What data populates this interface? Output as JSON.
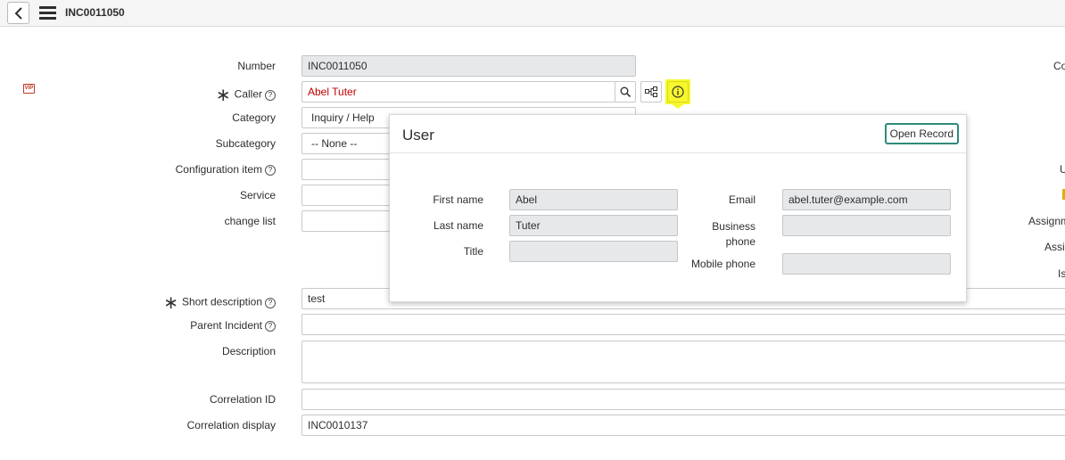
{
  "header": {
    "title": "INC0011050"
  },
  "form": {
    "number_label": "Number",
    "number_value": "INC0011050",
    "caller_label": "Caller",
    "caller_value": "Abel Tuter",
    "category_label": "Category",
    "category_value": "Inquiry / Help",
    "subcategory_label": "Subcategory",
    "subcategory_value": "-- None --",
    "config_item_label": "Configuration item",
    "service_label": "Service",
    "change_list_label": "change list",
    "short_desc_label": "Short description",
    "short_desc_value": "test",
    "parent_incident_label": "Parent Incident",
    "description_label": "Description",
    "correlation_id_label": "Correlation ID",
    "correlation_display_label": "Correlation display",
    "correlation_display_value": "INC0010137",
    "help_glyph": "?",
    "required_glyph": "∗"
  },
  "right_column": {
    "label_1": "Co",
    "label_2": "U",
    "label_3": "Assignm",
    "label_4": "Assig",
    "label_5": "Is"
  },
  "popup": {
    "title": "User",
    "open_record_label": "Open Record",
    "first_name_label": "First name",
    "first_name_value": "Abel",
    "last_name_label": "Last name",
    "last_name_value": "Tuter",
    "title_label": "Title",
    "title_value": "",
    "email_label": "Email",
    "email_value": "abel.tuter@example.com",
    "business_phone_label_1": "Business",
    "business_phone_label_2": "phone",
    "business_phone_value": "",
    "mobile_phone_label": "Mobile phone",
    "mobile_phone_value": ""
  },
  "colors": {
    "highlight": "#f7f72c",
    "caller_text": "#c00000",
    "open_record_border": "#2f8a7b"
  },
  "icons": {
    "back": "chevron-left-icon",
    "menu": "hamburger-menu-icon",
    "search": "search-icon",
    "hierarchy": "hierarchy-icon",
    "info": "info-icon",
    "vip": "vip-badge-icon"
  },
  "vip_badge_text": "VIP"
}
